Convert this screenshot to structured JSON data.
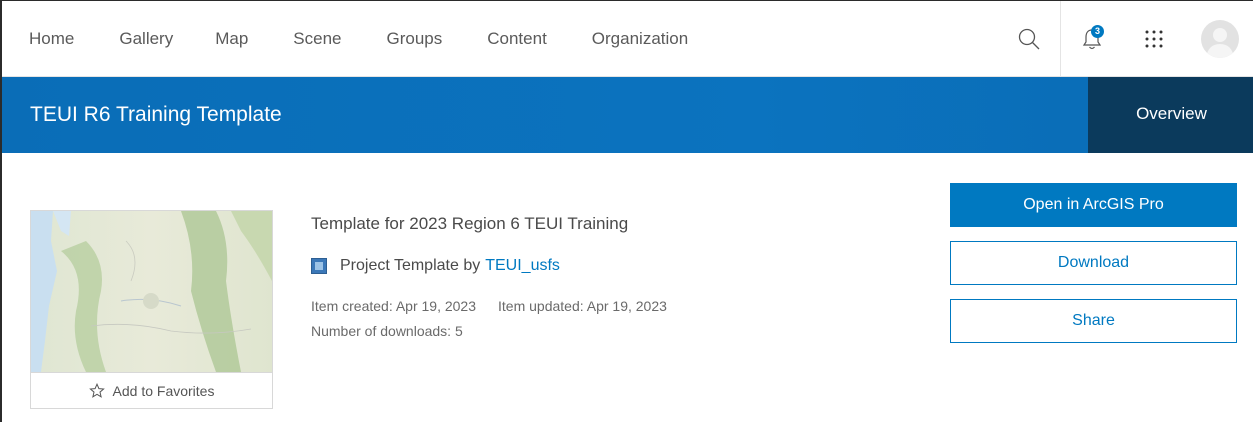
{
  "nav": {
    "links": [
      "Home",
      "Gallery",
      "Map",
      "Scene",
      "Groups",
      "Content",
      "Organization"
    ],
    "notification_count": "3",
    "icons": [
      "search-icon",
      "bell-icon",
      "apps-grid-icon",
      "avatar"
    ]
  },
  "header": {
    "title": "TEUI R6 Training Template",
    "active_tab": "Overview"
  },
  "item": {
    "title": "Template for 2023 Region 6 TEUI Training",
    "type_label": "Project Template by",
    "owner": "TEUI_usfs",
    "created": "Item created: Apr 19, 2023",
    "updated": "Item updated: Apr 19, 2023",
    "downloads": "Number of downloads: 5",
    "favorites_label": "Add to Favorites"
  },
  "actions": {
    "open": "Open in ArcGIS Pro",
    "download": "Download",
    "share": "Share"
  },
  "colors": {
    "accent": "#0079c1",
    "title_bar": "#0b73bf",
    "active_tab": "#0b3a5c"
  }
}
